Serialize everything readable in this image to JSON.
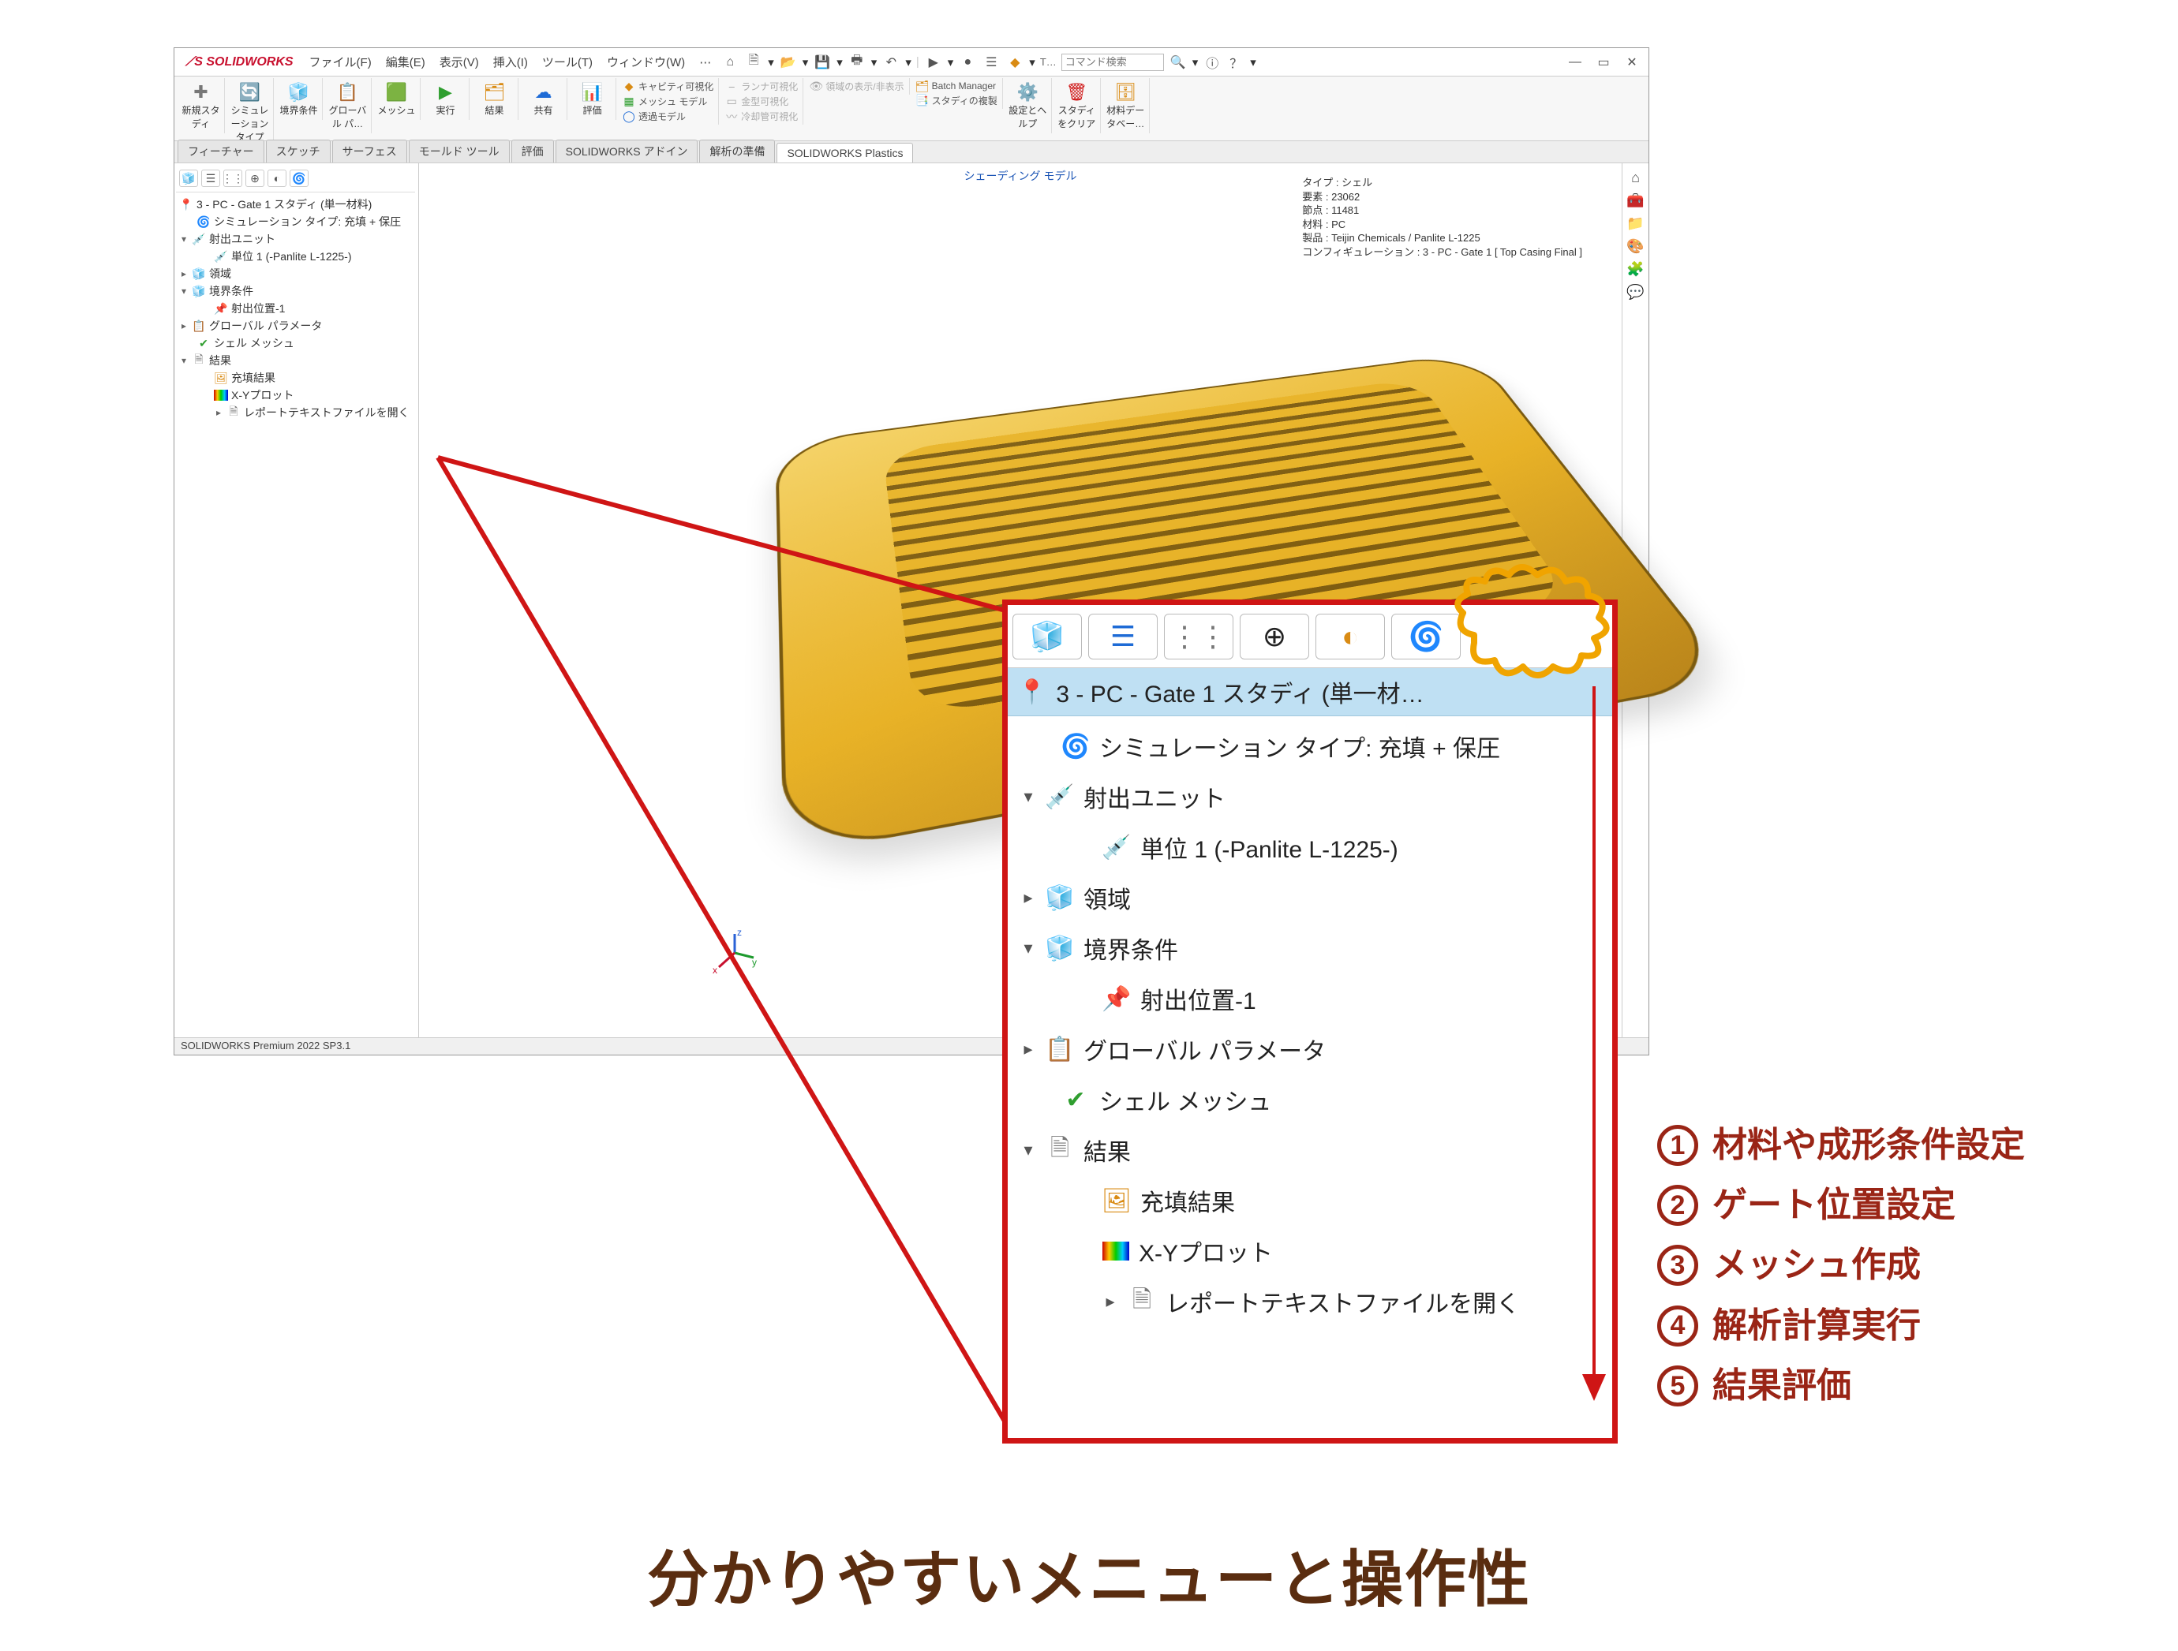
{
  "app": {
    "logo": "SOLIDWORKS",
    "menus": [
      "ファイル(F)",
      "編集(E)",
      "表示(V)",
      "挿入(I)",
      "ツール(T)",
      "ウィンドウ(W)"
    ],
    "search_placeholder": "コマンド検索"
  },
  "ribbon": {
    "big_buttons": [
      {
        "label": "新規スタディ"
      },
      {
        "label": "シミュレーション タイプ"
      },
      {
        "label": "境界条件"
      },
      {
        "label": "グローバル パ…"
      },
      {
        "label": "メッシュ"
      },
      {
        "label": "実行"
      },
      {
        "label": "結果"
      },
      {
        "label": "共有"
      },
      {
        "label": "評価"
      }
    ],
    "vis_group": [
      {
        "label": "キャビティ可視化",
        "enabled": true
      },
      {
        "label": "メッシュ モデル",
        "enabled": true
      },
      {
        "label": "透過モデル",
        "enabled": true
      },
      {
        "label": "ランナ可視化",
        "enabled": false
      },
      {
        "label": "金型可視化",
        "enabled": false
      },
      {
        "label": "冷却管可視化",
        "enabled": false
      }
    ],
    "area_group_label": "領域の表示/非表示",
    "batch_group": [
      {
        "label": "Batch Manager"
      },
      {
        "label": "スタディの複製"
      }
    ],
    "right_buttons": [
      {
        "label": "設定とヘルプ"
      },
      {
        "label": "スタディをクリア"
      },
      {
        "label": "材料データベー…"
      }
    ]
  },
  "tabs": [
    "フィーチャー",
    "スケッチ",
    "サーフェス",
    "モールド ツール",
    "評価",
    "SOLIDWORKS アドイン",
    "解析の準備",
    "SOLIDWORKS Plastics"
  ],
  "viewport": {
    "heads_up": "シェーディング モデル",
    "info": {
      "l1": "タイプ : シェル",
      "l2": "要素 : 23062",
      "l3": "節点 : 11481",
      "l4": "材料 : PC",
      "l5": "製品 : Teijin Chemicals / Panlite L-1225",
      "l6": "コンフィギュレーション : 3 - PC - Gate 1 [ Top Casing Final ]"
    }
  },
  "status_bar": "SOLIDWORKS Premium 2022 SP3.1",
  "tree": {
    "root": "3 - PC - Gate 1 スタディ (単一材料)",
    "sim_type": "シミュレーション タイプ: 充填 + 保圧",
    "inject_unit": "射出ユニット",
    "material": "単位 1 (-Panlite L-1225-)",
    "domain": "領域",
    "bc": "境界条件",
    "bc_item": "射出位置-1",
    "global": "グローバル パラメータ",
    "mesh": "シェル メッシュ",
    "results": "結果",
    "res_fill": "充填結果",
    "res_xy": "X-Yプロット",
    "res_report": "レポートテキストファイルを開く"
  },
  "zoom": {
    "root": "3 - PC - Gate 1 スタディ (単一材…",
    "sim_type": "シミュレーション タイプ: 充填 + 保圧",
    "inject_unit": "射出ユニット",
    "material": "単位 1 (-Panlite L-1225-)",
    "domain": "領域",
    "bc": "境界条件",
    "bc_item": "射出位置-1",
    "global": "グローバル パラメータ",
    "mesh": "シェル メッシュ",
    "results": "結果",
    "res_fill": "充填結果",
    "res_xy": "X-Yプロット",
    "res_report": "レポートテキストファイルを開く"
  },
  "steps": {
    "s1": "材料や成形条件設定",
    "s2": "ゲート位置設定",
    "s3": "メッシュ作成",
    "s4": "解析計算実行",
    "s5": "結果評価"
  },
  "headline": "分かりやすいメニューと操作性"
}
